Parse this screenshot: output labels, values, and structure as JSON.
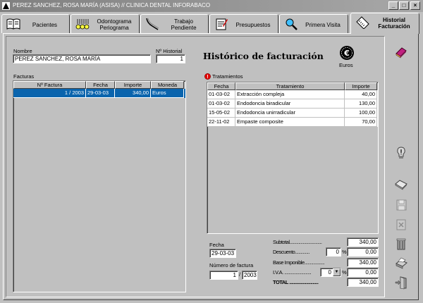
{
  "window": {
    "title": "PEREZ SANCHEZ, ROSA MARÍA (ASISA) // CLINICA DENTAL INFORABACO",
    "buttons": {
      "minimize": "_",
      "maximize": "□",
      "close": "×"
    }
  },
  "tabs": [
    {
      "label": "Pacientes",
      "icon": "book-icon"
    },
    {
      "label": "Odontograma\nPeriograma",
      "icon": "teeth-icon"
    },
    {
      "label": "Trabajo\nPendiente",
      "icon": "dental-tool-icon"
    },
    {
      "label": "Presupuestos",
      "icon": "document-icon"
    },
    {
      "label": "Primera Visita",
      "icon": "magnifier-icon"
    },
    {
      "label": "Historial\nFacturación",
      "icon": "ruler-icon",
      "active": true
    }
  ],
  "patient": {
    "name_label": "Nombre",
    "name": "PEREZ SANCHEZ, ROSA MARÍA",
    "historial_label": "Nº Historial",
    "historial": "1"
  },
  "heading": "Histórico de facturación",
  "currency": {
    "symbol": "€",
    "label": "Euros"
  },
  "facturas": {
    "label": "Facturas",
    "columns": [
      "Nº Factura",
      "Fecha",
      "Importe",
      "Moneda"
    ],
    "rows": [
      {
        "numero": "1 / 2003",
        "fecha": "29-03-03",
        "importe": "340,00",
        "moneda": "Euros",
        "selected": true
      }
    ]
  },
  "tratamientos": {
    "label": "Tratamientos",
    "columns": [
      "Fecha",
      "Tratamiento",
      "Importe"
    ],
    "rows": [
      {
        "fecha": "01-03-02",
        "tratamiento": "Extracción compleja",
        "importe": "40,00"
      },
      {
        "fecha": "01-03-02",
        "tratamiento": "Endodoncia biradicular",
        "importe": "130,00"
      },
      {
        "fecha": "15-05-02",
        "tratamiento": "Endodoncia unirradicular",
        "importe": "100,00"
      },
      {
        "fecha": "22-11-02",
        "tratamiento": "Empaste composite",
        "importe": "70,00"
      }
    ]
  },
  "invoice": {
    "fecha_label": "Fecha",
    "fecha": "29-03-03",
    "numero_label": "Número de factura",
    "numero": "1",
    "numero_sep": "/",
    "anio": "2003"
  },
  "totals": {
    "subtotal_label": "Subtotal.............................",
    "subtotal": "340,00",
    "descuento_label": "Descuento.............",
    "descuento_pct": "0",
    "descuento": "0,00",
    "base_label": "Base Imponible..................",
    "base": "340,00",
    "iva_label": "I.V.A. ........................",
    "iva_pct": "0",
    "iva": "0,00",
    "total_label": "TOTAL ..........................",
    "total": "340,00",
    "pct_symbol": "%"
  },
  "side_icons": [
    "book-red-icon",
    "alert-bulb-icon",
    "open-folder-icon",
    "save-disk-icon",
    "close-doc-icon",
    "trash-icon",
    "printer-icon",
    "exit-door-icon"
  ]
}
